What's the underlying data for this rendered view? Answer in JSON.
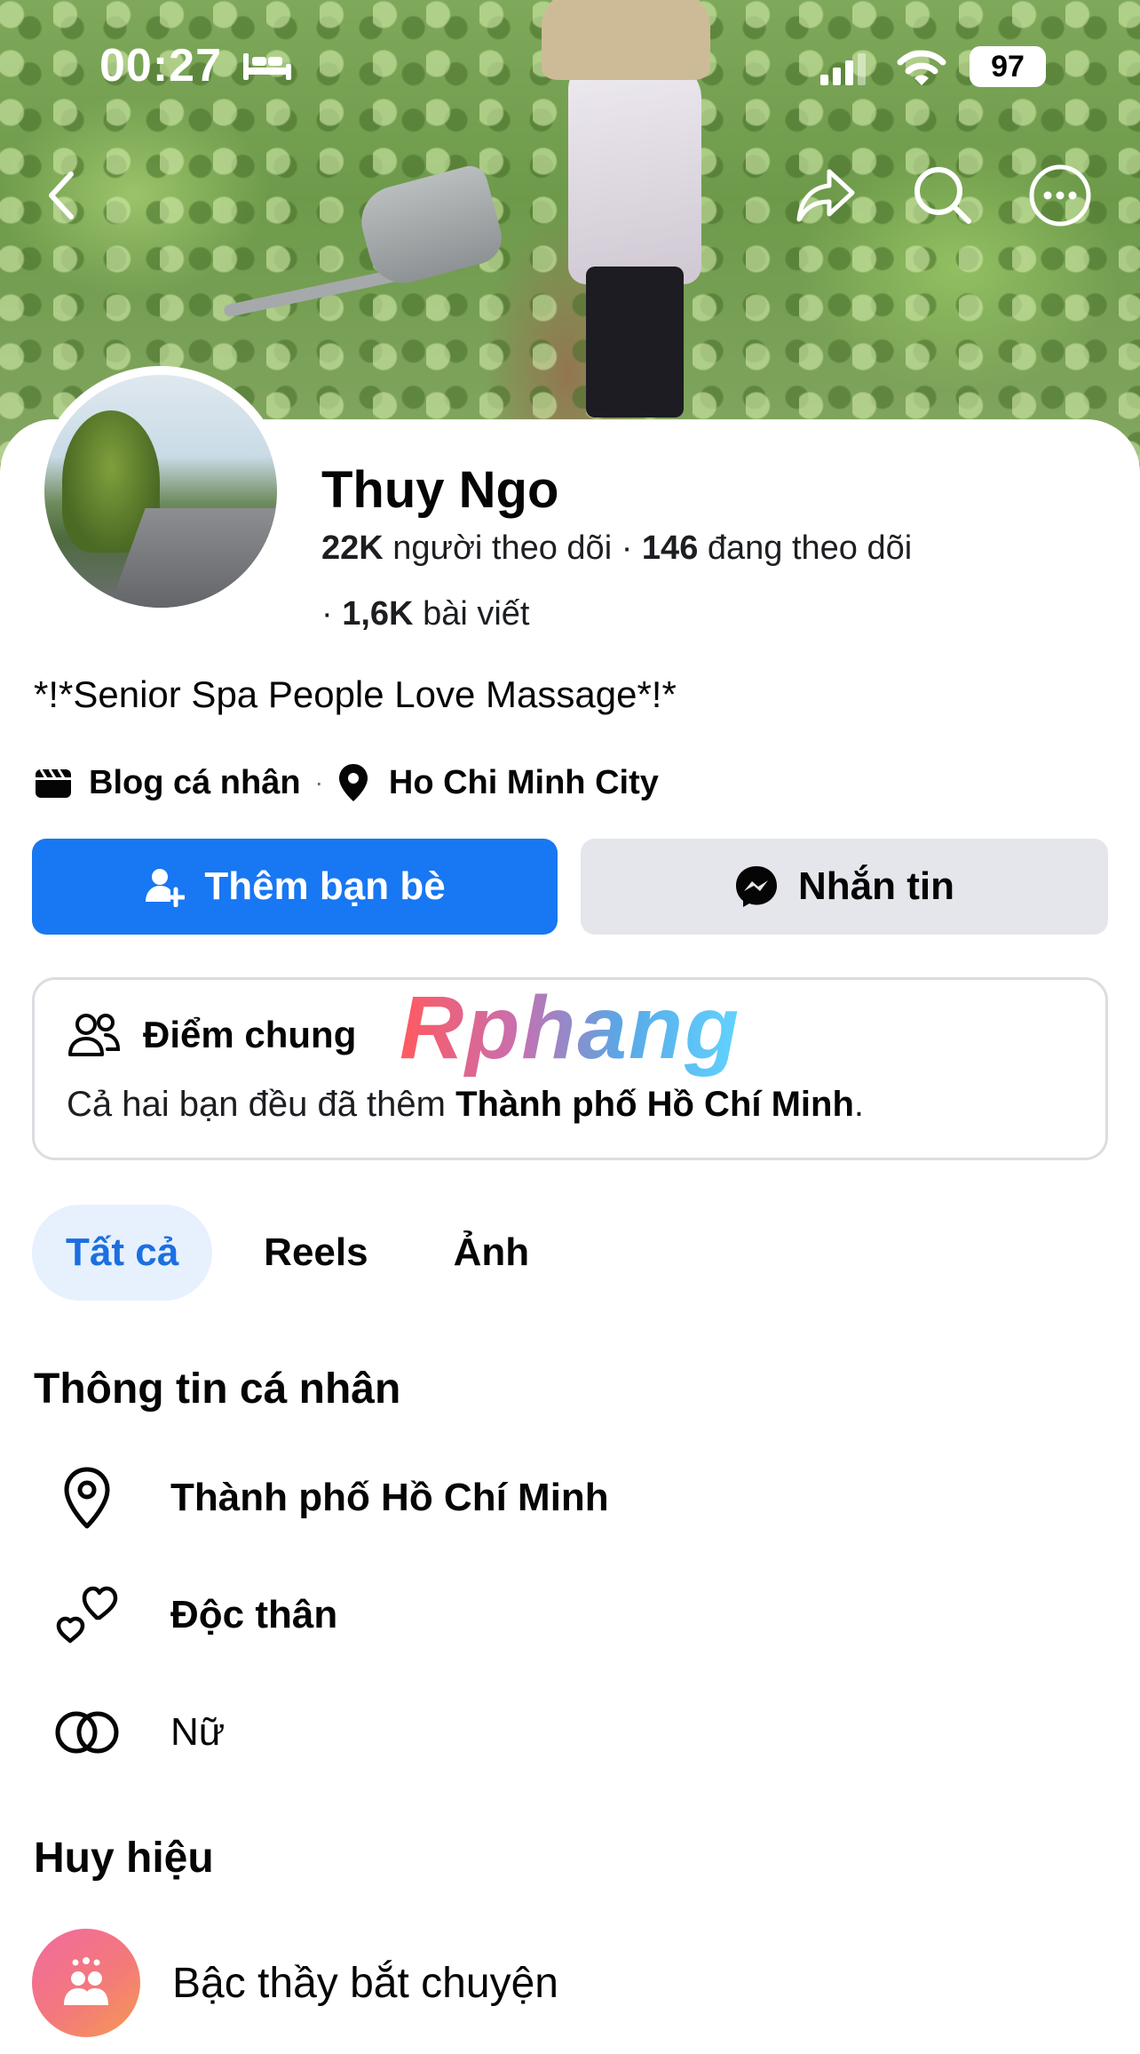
{
  "status_bar": {
    "time": "00:27",
    "battery": "97",
    "icons": [
      "bed-icon",
      "signal-icon",
      "wifi-icon",
      "battery-icon"
    ]
  },
  "nav": {
    "icons": [
      "back-icon",
      "share-icon",
      "search-icon",
      "more-icon"
    ]
  },
  "profile": {
    "name": "Thuy Ngo",
    "followers_count": "22K",
    "followers_label": "người theo dõi",
    "separator": "·",
    "following_count": "146",
    "following_label": "đang theo dõi",
    "posts_prefix": "·",
    "posts_count": "1,6K",
    "posts_label": "bài viết",
    "bio": "*!*Senior Spa People Love Massage*!*",
    "category": "Blog cá nhân",
    "meta_separator": "·",
    "location": "Ho Chi Minh City"
  },
  "actions": {
    "add_friend": "Thêm bạn bè",
    "message": "Nhắn tin",
    "accent_color": "#1877f2"
  },
  "mutual": {
    "title": "Điểm chung",
    "text_prefix": "Cả hai bạn đều đã thêm",
    "text_bold": "Thành phố Hồ Chí Minh",
    "text_suffix": "."
  },
  "watermark": "Rphang",
  "tabs": [
    {
      "label": "Tất cả",
      "active": true
    },
    {
      "label": "Reels",
      "active": false
    },
    {
      "label": "Ảnh",
      "active": false
    }
  ],
  "personal_info": {
    "title": "Thông tin cá nhân",
    "items": [
      {
        "icon": "location-pin-icon",
        "label": "Thành phố Hồ Chí Minh"
      },
      {
        "icon": "hearts-icon",
        "label": "Độc thân"
      },
      {
        "icon": "gender-rings-icon",
        "label": "Nữ"
      }
    ]
  },
  "badges": {
    "title": "Huy hiệu",
    "items": [
      {
        "icon": "conversation-starter-icon",
        "label": "Bậc thầy bắt chuyện"
      }
    ]
  }
}
